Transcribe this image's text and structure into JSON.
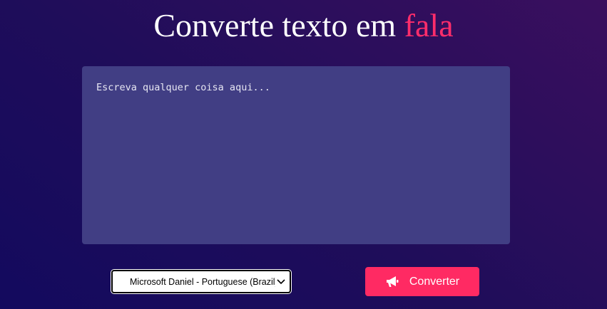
{
  "header": {
    "title_main": "Converte texto em ",
    "title_accent": "fala"
  },
  "editor": {
    "placeholder": "Escreva qualquer coisa aqui...",
    "value": ""
  },
  "voice_select": {
    "selected": "Microsoft Daniel - Portuguese (Brazil)"
  },
  "convert_button": {
    "label": "Converter",
    "icon": "megaphone-icon"
  },
  "colors": {
    "accent": "#ff2a63",
    "editor_bg": "#413e84",
    "bg_start": "#130a5e",
    "bg_end": "#3a0f5e"
  }
}
